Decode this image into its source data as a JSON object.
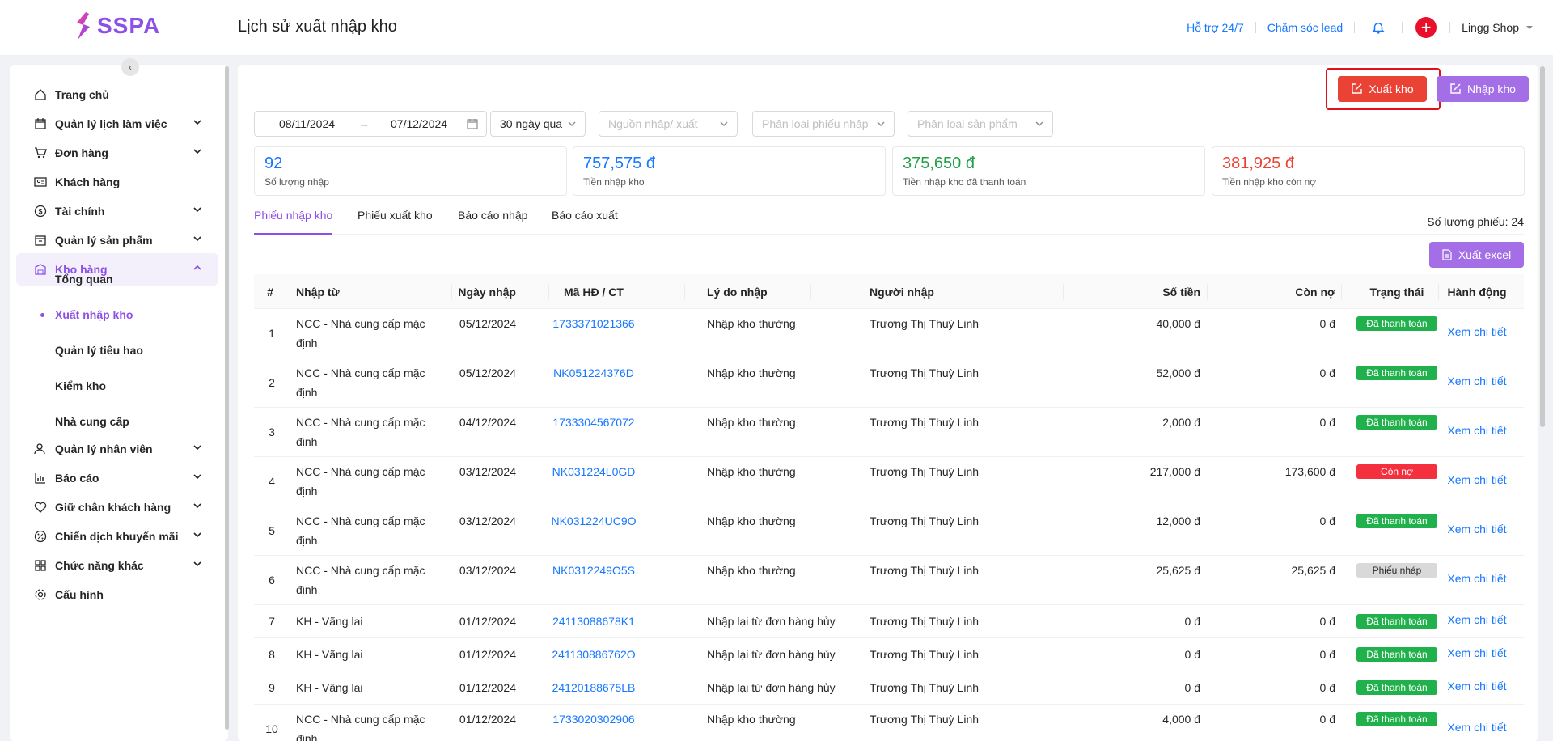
{
  "app": {
    "logo": "SSPA",
    "page_title": "Lịch sử xuất nhập kho"
  },
  "header": {
    "support": "Hỗ trợ 24/7",
    "lead": "Chăm sóc lead",
    "shop": "Lingg Shop"
  },
  "sidebar": {
    "items": [
      {
        "label": "Trang chủ",
        "icon": "home-icon"
      },
      {
        "label": "Quản lý lịch làm việc",
        "icon": "calendar-icon"
      },
      {
        "label": "Đơn hàng",
        "icon": "cart-icon"
      },
      {
        "label": "Khách hàng",
        "icon": "contact-card-icon"
      },
      {
        "label": "Tài chính",
        "icon": "dollar-icon"
      },
      {
        "label": "Quản lý sản phẩm",
        "icon": "box-icon"
      },
      {
        "label": "Kho hàng",
        "icon": "warehouse-icon"
      },
      {
        "label": "Quản lý nhân viên",
        "icon": "user-icon"
      },
      {
        "label": "Báo cáo",
        "icon": "chart-icon"
      },
      {
        "label": "Giữ chân khách hàng",
        "icon": "heart-icon"
      },
      {
        "label": "Chiến dịch khuyến mãi",
        "icon": "percent-icon"
      },
      {
        "label": "Chức năng khác",
        "icon": "apps-icon"
      },
      {
        "label": "Cấu hình",
        "icon": "gear-icon"
      }
    ],
    "sub_items": [
      "Tổng quan",
      "Xuất nhập kho",
      "Quản lý tiêu hao",
      "Kiểm kho",
      "Nhà cung cấp"
    ]
  },
  "actions": {
    "export": "Xuất kho",
    "import": "Nhập kho",
    "excel": "Xuất excel"
  },
  "filters": {
    "date_start": "08/11/2024",
    "date_end": "07/12/2024",
    "range": "30 ngày qua",
    "source_placeholder": "Nguồn nhập/ xuất",
    "type_placeholder": "Phân loại phiếu nhập",
    "product_placeholder": "Phân loại sản phẩm"
  },
  "stats": [
    {
      "value": "92",
      "label": "Số lượng nhập",
      "color": "#1677ff"
    },
    {
      "value": "757,575 đ",
      "label": "Tiền nhập kho",
      "color": "#1677ff"
    },
    {
      "value": "375,650 đ",
      "label": "Tiền nhập kho đã thanh toán",
      "color": "#21a047"
    },
    {
      "value": "381,925 đ",
      "label": "Tiền nhập kho còn nợ",
      "color": "#ea4335"
    }
  ],
  "tabs": [
    "Phiếu nhập kho",
    "Phiếu xuất kho",
    "Báo cáo nhập",
    "Báo cáo xuất"
  ],
  "count_label": "Số lượng phiếu: 24",
  "table": {
    "columns": [
      "#",
      "Nhập từ",
      "Ngày nhập",
      "Mã HĐ / CT",
      "Lý do nhập",
      "Người nhập",
      "Số tiền",
      "Còn nợ",
      "Trạng thái",
      "Hành động"
    ],
    "rows": [
      {
        "idx": "1",
        "from1": "NCC - Nhà cung cấp mặc",
        "from2": "định",
        "date": "05/12/2024",
        "code": "1733371021366",
        "reason": "Nhập kho thường",
        "person": "Trương Thị Thuỳ Linh",
        "amount": "40,000 đ",
        "debt": "0 đ",
        "status": "Đã thanh toán",
        "status_type": "paid",
        "action": "Xem chi tiết"
      },
      {
        "idx": "2",
        "from1": "NCC - Nhà cung cấp mặc",
        "from2": "định",
        "date": "05/12/2024",
        "code": "NK051224376D",
        "reason": "Nhập kho thường",
        "person": "Trương Thị Thuỳ Linh",
        "amount": "52,000 đ",
        "debt": "0 đ",
        "status": "Đã thanh toán",
        "status_type": "paid",
        "action": "Xem chi tiết"
      },
      {
        "idx": "3",
        "from1": "NCC - Nhà cung cấp mặc",
        "from2": "định",
        "date": "04/12/2024",
        "code": "1733304567072",
        "reason": "Nhập kho thường",
        "person": "Trương Thị Thuỳ Linh",
        "amount": "2,000 đ",
        "debt": "0 đ",
        "status": "Đã thanh toán",
        "status_type": "paid",
        "action": "Xem chi tiết"
      },
      {
        "idx": "4",
        "from1": "NCC - Nhà cung cấp mặc",
        "from2": "định",
        "date": "03/12/2024",
        "code": "NK031224L0GD",
        "reason": "Nhập kho thường",
        "person": "Trương Thị Thuỳ Linh",
        "amount": "217,000 đ",
        "debt": "173,600 đ",
        "status": "Còn nợ",
        "status_type": "debt",
        "action": "Xem chi tiết"
      },
      {
        "idx": "5",
        "from1": "NCC - Nhà cung cấp mặc",
        "from2": "định",
        "date": "03/12/2024",
        "code": "NK031224UC9O",
        "reason": "Nhập kho thường",
        "person": "Trương Thị Thuỳ Linh",
        "amount": "12,000 đ",
        "debt": "0 đ",
        "status": "Đã thanh toán",
        "status_type": "paid",
        "action": "Xem chi tiết"
      },
      {
        "idx": "6",
        "from1": "NCC - Nhà cung cấp mặc",
        "from2": "định",
        "date": "03/12/2024",
        "code": "NK0312249O5S",
        "reason": "Nhập kho thường",
        "person": "Trương Thị Thuỳ Linh",
        "amount": "25,625 đ",
        "debt": "25,625 đ",
        "status": "Phiếu nháp",
        "status_type": "draft",
        "action": "Xem chi tiết"
      },
      {
        "idx": "7",
        "from1": "KH - Vãng lai",
        "from2": "",
        "date": "01/12/2024",
        "code": "24113088678K1",
        "reason": "Nhập lại từ đơn hàng hủy",
        "person": "Trương Thị Thuỳ Linh",
        "amount": "0 đ",
        "debt": "0 đ",
        "status": "Đã thanh toán",
        "status_type": "paid",
        "action": "Xem chi tiết"
      },
      {
        "idx": "8",
        "from1": "KH - Vãng lai",
        "from2": "",
        "date": "01/12/2024",
        "code": "241130886762O",
        "reason": "Nhập lại từ đơn hàng hủy",
        "person": "Trương Thị Thuỳ Linh",
        "amount": "0 đ",
        "debt": "0 đ",
        "status": "Đã thanh toán",
        "status_type": "paid",
        "action": "Xem chi tiết"
      },
      {
        "idx": "9",
        "from1": "KH - Vãng lai",
        "from2": "",
        "date": "01/12/2024",
        "code": "24120188675LB",
        "reason": "Nhập lại từ đơn hàng hủy",
        "person": "Trương Thị Thuỳ Linh",
        "amount": "0 đ",
        "debt": "0 đ",
        "status": "Đã thanh toán",
        "status_type": "paid",
        "action": "Xem chi tiết"
      },
      {
        "idx": "10",
        "from1": "NCC - Nhà cung cấp mặc",
        "from2": "định",
        "date": "01/12/2024",
        "code": "1733020302906",
        "reason": "Nhập kho thường",
        "person": "Trương Thị Thuỳ Linh",
        "amount": "4,000 đ",
        "debt": "0 đ",
        "status": "Đã thanh toán",
        "status_type": "paid",
        "action": "Xem chi tiết"
      }
    ]
  }
}
